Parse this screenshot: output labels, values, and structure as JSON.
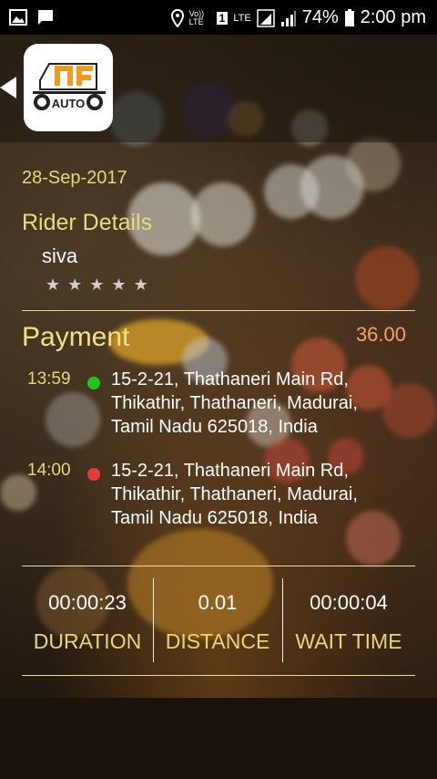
{
  "status_bar": {
    "battery": "74%",
    "time": "2:00 pm",
    "network": "LTE",
    "volte": "Vo)) LTE",
    "sim": "1"
  },
  "logo": {
    "text": "AUTO",
    "colors": {
      "orange": "#f39a1e",
      "dark": "#222222"
    }
  },
  "trip": {
    "date": "28-Sep-2017",
    "rider_title": "Rider Details",
    "rider_name": "siva",
    "rating": 0,
    "stars_max": 5,
    "payment_title": "Payment",
    "payment_amount": "36.00",
    "stops": [
      {
        "time": "13:59",
        "dot_color": "#22c41e",
        "address": "15-2-21, Thathaneri Main Rd, Thikathir, Thathaneri, Madurai, Tamil Nadu 625018, India"
      },
      {
        "time": "14:00",
        "dot_color": "#e8393c",
        "address": "15-2-21, Thathaneri Main Rd, Thikathir, Thathaneri, Madurai, Tamil Nadu 625018, India"
      }
    ],
    "stats": [
      {
        "value": "00:00:23",
        "label": "DURATION"
      },
      {
        "value": "0.01",
        "label": "DISTANCE"
      },
      {
        "value": "00:00:04",
        "label": "WAIT TIME"
      }
    ]
  },
  "colors": {
    "accent_yellow": "#e8d67a",
    "amount_orange": "#f2a26a"
  }
}
